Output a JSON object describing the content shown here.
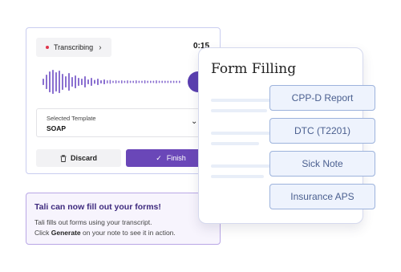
{
  "recorder": {
    "status_label": "Transcribing",
    "timer": "0:15",
    "template_label": "Selected Template",
    "template_value": "SOAP",
    "discard_label": "Discard",
    "finish_label": "Finish"
  },
  "info": {
    "title": "Tali can now fill out your forms!",
    "line1": "Tali fills out forms using your transcript.",
    "line2_pre": "Click ",
    "line2_bold": "Generate",
    "line2_post": " on your note to see it in action."
  },
  "form": {
    "title": "Form Filling",
    "options": [
      "CPP-D Report",
      "DTC (T2201)",
      "Sick Note",
      "Insurance APS"
    ]
  },
  "colors": {
    "accent": "#6a47b8",
    "recording_dot": "#e0354b",
    "option_border": "#9db3dc"
  },
  "icons": {
    "status": "recording-dot-icon",
    "discard": "trash-icon",
    "finish": "check-icon",
    "template": "chevron-down-icon"
  }
}
